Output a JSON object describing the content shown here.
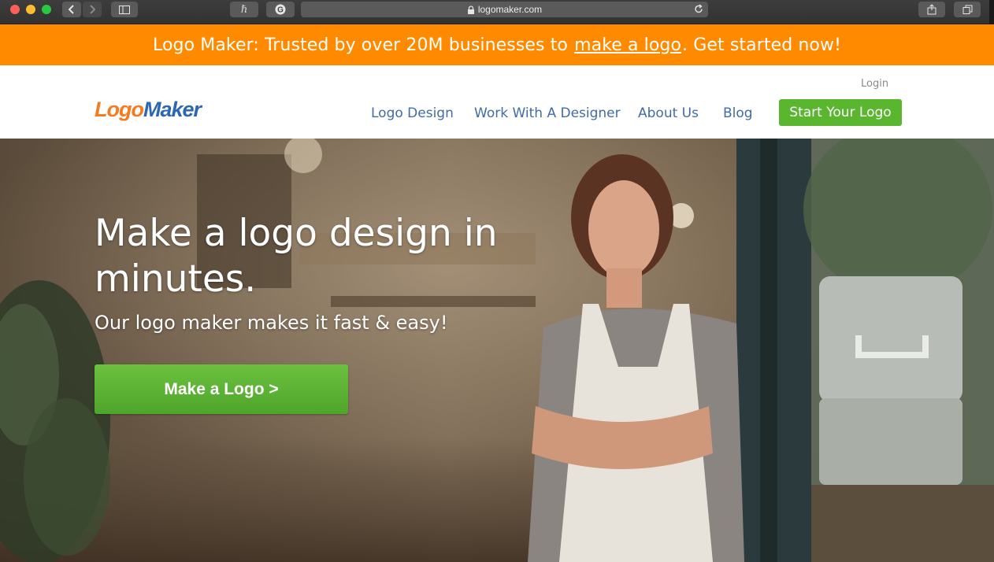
{
  "browser": {
    "url": "logomaker.com",
    "icons": [
      "back-icon",
      "forward-icon",
      "sidebar-icon",
      "extension-icon",
      "grammarly-icon",
      "lock-icon",
      "reload-icon",
      "share-icon",
      "tabs-icon"
    ]
  },
  "promo": {
    "before": "Logo Maker: Trusted by over 20M businesses to",
    "link": "make a logo",
    "after": ". Get started now!"
  },
  "header": {
    "logo_part1": "Logo",
    "logo_part2": "Maker",
    "login": "Login",
    "nav": [
      "Logo Design",
      "Work With A Designer",
      "About Us",
      "Blog"
    ],
    "cta": "Start Your Logo"
  },
  "hero": {
    "title": "Make a logo design in minutes.",
    "subtitle": "Our logo maker makes it fast & easy!",
    "button": "Make a Logo >"
  },
  "colors": {
    "promo": "#ff8a00",
    "nav": "#3f6ca8",
    "green": "#5ab52f",
    "logo_orange": "#f47b20",
    "logo_blue": "#2e67b1"
  }
}
